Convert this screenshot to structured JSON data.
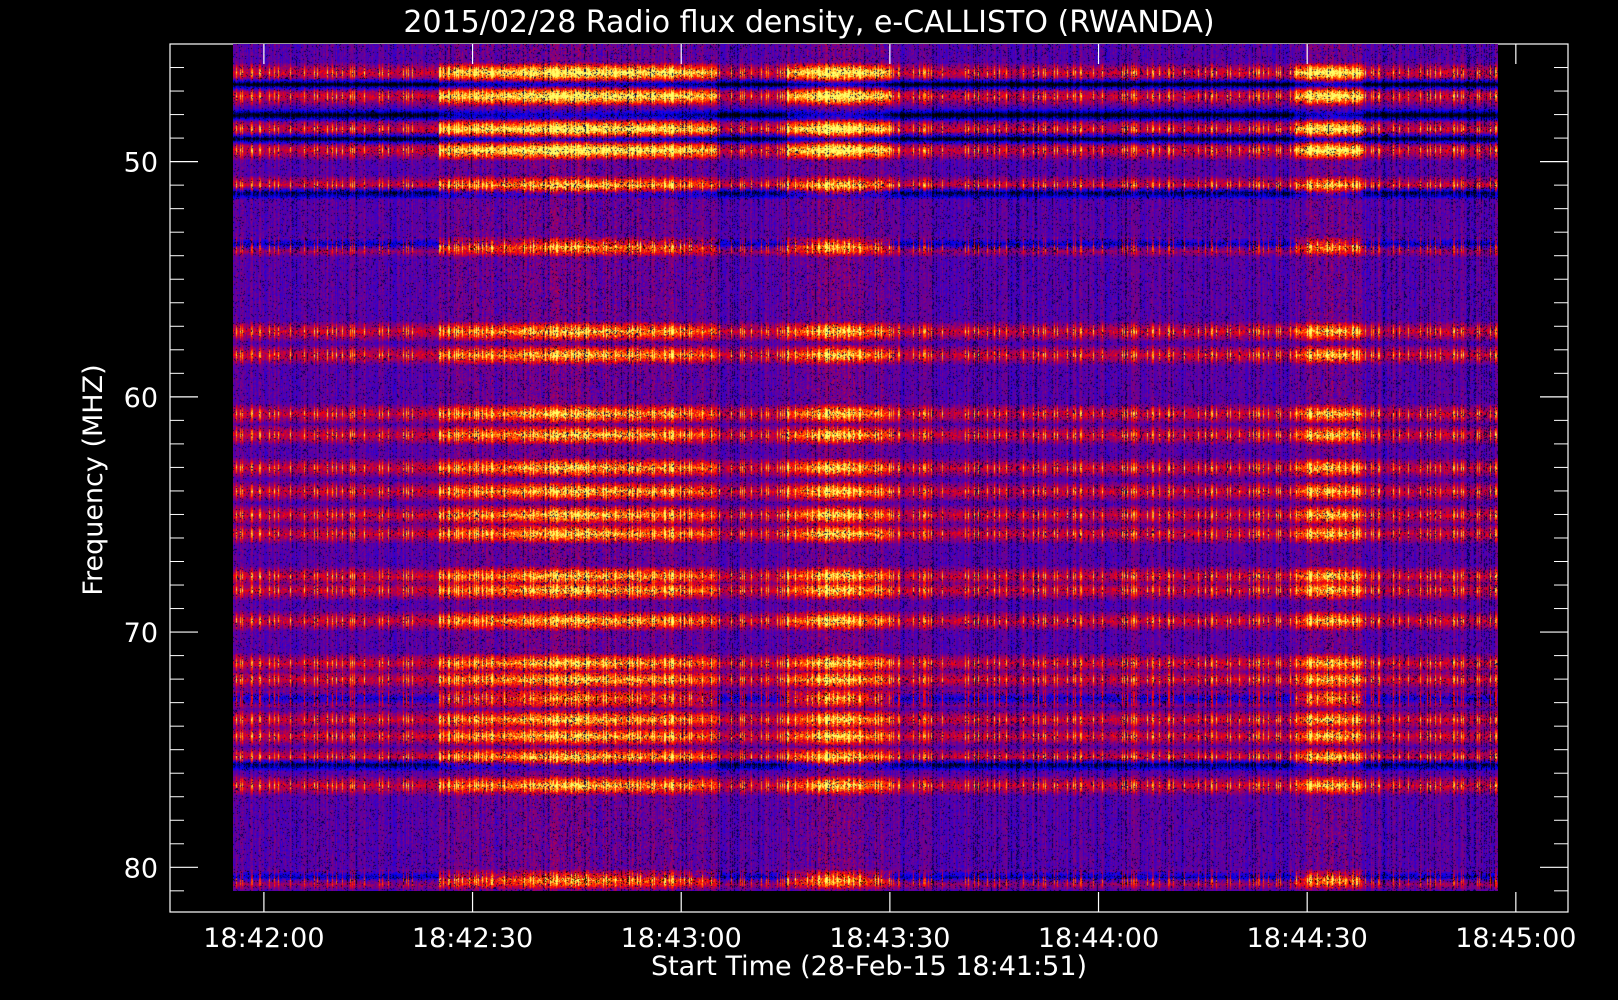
{
  "chart_data": {
    "type": "heatmap",
    "title": "2015/02/28  Radio flux density, e-CALLISTO (RWANDA)",
    "xlabel": "Start Time (28-Feb-15 18:41:51)",
    "ylabel": "Frequency (MHZ)",
    "x_ticks": [
      "18:42:00",
      "18:42:30",
      "18:43:00",
      "18:43:30",
      "18:44:00",
      "18:44:30",
      "18:45:00"
    ],
    "x_tick_seconds": [
      0,
      30,
      60,
      90,
      120,
      150,
      180
    ],
    "xlim_seconds": [
      -13.5,
      187.5
    ],
    "data_xlim_seconds": [
      -4.5,
      177.5
    ],
    "y_ticks": [
      "50",
      "60",
      "70",
      "80"
    ],
    "y_tick_values": [
      50,
      60,
      70,
      80
    ],
    "ylim": [
      45,
      81.9
    ],
    "y_inverted": true,
    "data_ylim": [
      45,
      81
    ],
    "colormap": [
      "#000000",
      "#0000ff",
      "#ff0000",
      "#ff8800",
      "#ffff66"
    ],
    "bright_bands_mhz": [
      46.2,
      47.2,
      48.6,
      49.5,
      51.0,
      53.6,
      57.2,
      58.2,
      60.7,
      61.6,
      63.0,
      64.0,
      65.0,
      65.8,
      67.6,
      68.2,
      69.5,
      71.3,
      72.0,
      72.8,
      73.7,
      74.4,
      75.3,
      76.5,
      80.5
    ],
    "dark_bands_mhz": [
      46.7,
      48.0,
      49.0,
      51.3,
      53.5,
      72.8,
      75.6,
      80.4
    ],
    "active_time_windows_seconds": [
      [
        25,
        65
      ],
      [
        75,
        90
      ],
      [
        148,
        158
      ]
    ]
  }
}
